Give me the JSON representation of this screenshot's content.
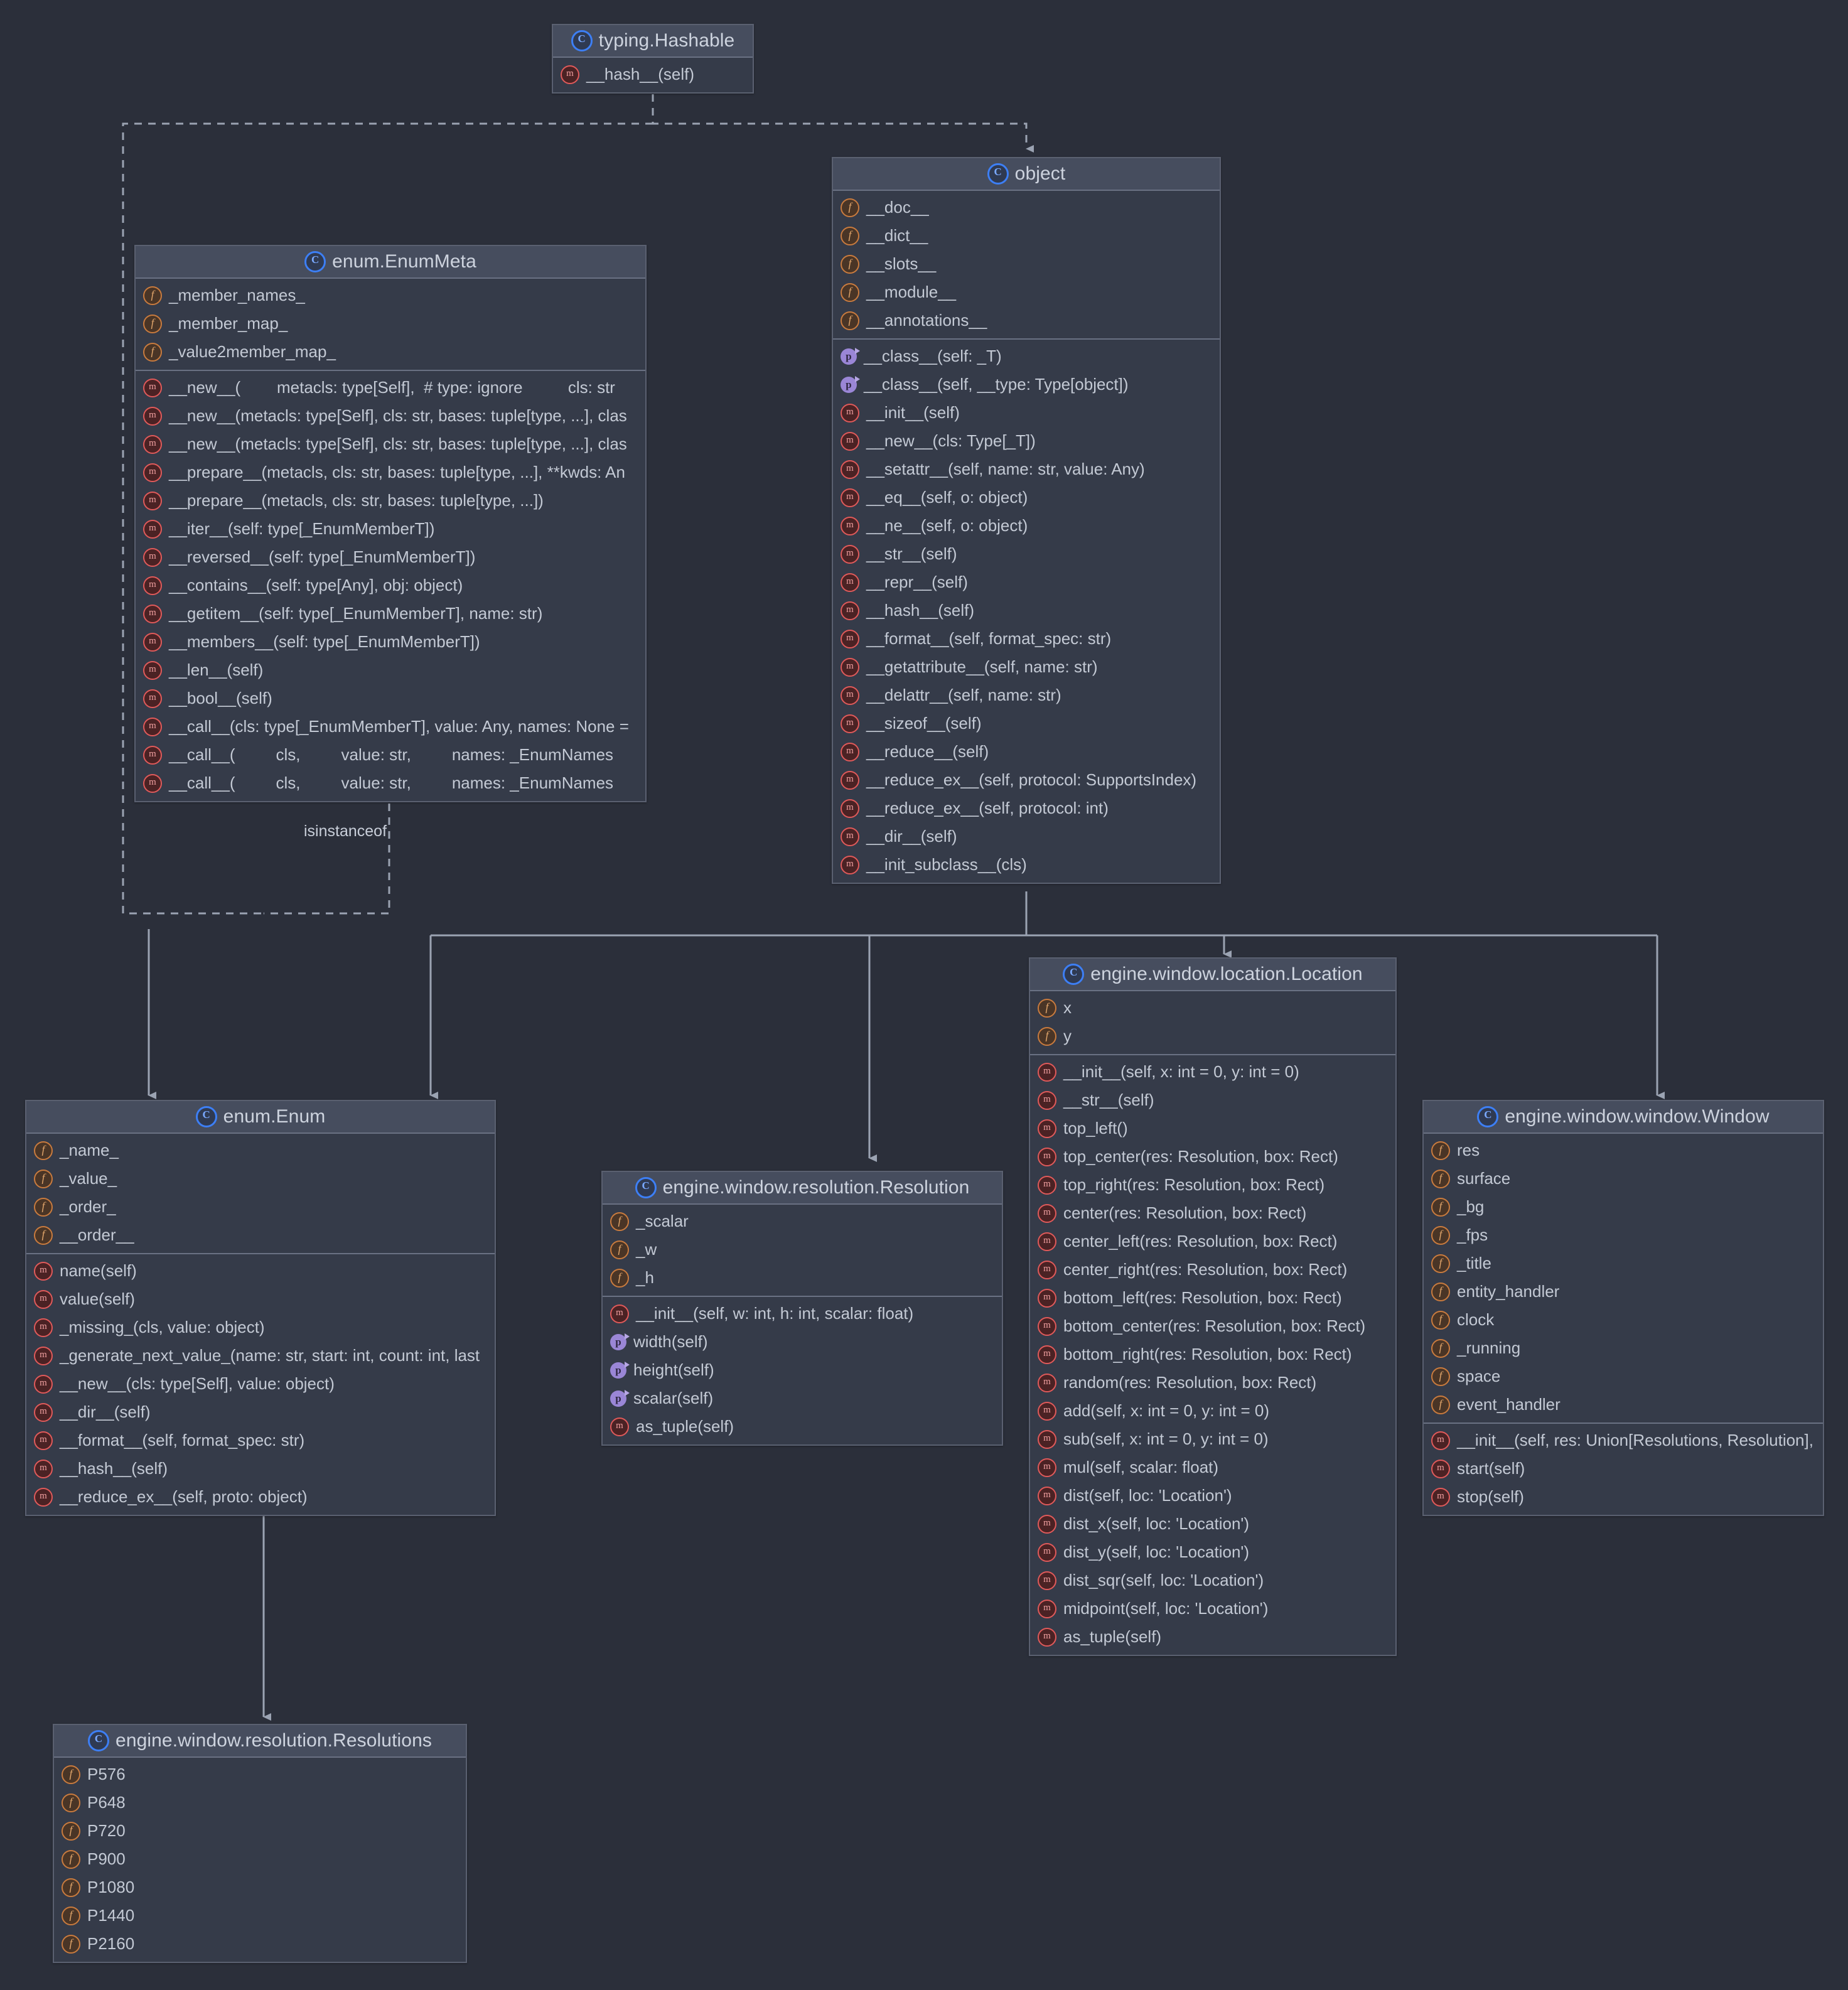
{
  "diagram": {
    "kind": "uml-class-diagram",
    "background": "#2b2f3a",
    "box_fill": "#353b49",
    "header_fill": "#464d5e",
    "border": "#5a6070",
    "text": "#c3c9d4",
    "class_icon_color": "#3d7ff5",
    "field_icon_color": "#c97b3e",
    "method_icon_color": "#e05a5a",
    "property_icon_color": "#9a86d6"
  },
  "edge_labels": [
    {
      "text": "isinstanceof"
    }
  ],
  "classes": [
    {
      "id": "hashable",
      "title": "typing.Hashable",
      "icon": "class-icon",
      "sections": [
        {
          "members": [
            {
              "icon": "method-icon",
              "text": "__hash__(self)"
            }
          ]
        }
      ]
    },
    {
      "id": "object",
      "title": "object",
      "icon": "class-icon",
      "sections": [
        {
          "members": [
            {
              "icon": "field-icon",
              "text": "__doc__"
            },
            {
              "icon": "field-icon",
              "text": "__dict__"
            },
            {
              "icon": "field-icon",
              "text": "__slots__"
            },
            {
              "icon": "field-icon",
              "text": "__module__"
            },
            {
              "icon": "field-icon",
              "text": "__annotations__"
            }
          ]
        },
        {
          "members": [
            {
              "icon": "property-icon",
              "text": "__class__(self: _T)"
            },
            {
              "icon": "property-icon",
              "text": "__class__(self, __type: Type[object])"
            },
            {
              "icon": "method-icon",
              "text": "__init__(self)"
            },
            {
              "icon": "method-icon",
              "text": "__new__(cls: Type[_T])"
            },
            {
              "icon": "method-icon",
              "text": "__setattr__(self, name: str, value: Any)"
            },
            {
              "icon": "method-icon",
              "text": "__eq__(self, o: object)"
            },
            {
              "icon": "method-icon",
              "text": "__ne__(self, o: object)"
            },
            {
              "icon": "method-icon",
              "text": "__str__(self)"
            },
            {
              "icon": "method-icon",
              "text": "__repr__(self)"
            },
            {
              "icon": "method-icon",
              "text": "__hash__(self)"
            },
            {
              "icon": "method-icon",
              "text": "__format__(self, format_spec: str)"
            },
            {
              "icon": "method-icon",
              "text": "__getattribute__(self, name: str)"
            },
            {
              "icon": "method-icon",
              "text": "__delattr__(self, name: str)"
            },
            {
              "icon": "method-icon",
              "text": "__sizeof__(self)"
            },
            {
              "icon": "method-icon",
              "text": "__reduce__(self)"
            },
            {
              "icon": "method-icon",
              "text": "__reduce_ex__(self, protocol: SupportsIndex)"
            },
            {
              "icon": "method-icon",
              "text": "__reduce_ex__(self, protocol: int)"
            },
            {
              "icon": "method-icon",
              "text": "__dir__(self)"
            },
            {
              "icon": "method-icon",
              "text": "__init_subclass__(cls)"
            }
          ]
        }
      ]
    },
    {
      "id": "enummeta",
      "title": "enum.EnumMeta",
      "icon": "class-icon",
      "sections": [
        {
          "members": [
            {
              "icon": "field-icon",
              "text": "_member_names_"
            },
            {
              "icon": "field-icon",
              "text": "_member_map_"
            },
            {
              "icon": "field-icon",
              "text": "_value2member_map_"
            }
          ]
        },
        {
          "members": [
            {
              "icon": "method-icon",
              "text": "__new__(        metacls: type[Self],  # type: ignore          cls: str"
            },
            {
              "icon": "method-icon",
              "text": "__new__(metacls: type[Self], cls: str, bases: tuple[type, ...], clas"
            },
            {
              "icon": "method-icon",
              "text": "__new__(metacls: type[Self], cls: str, bases: tuple[type, ...], clas"
            },
            {
              "icon": "method-icon",
              "text": "__prepare__(metacls, cls: str, bases: tuple[type, ...], **kwds: An"
            },
            {
              "icon": "method-icon",
              "text": "__prepare__(metacls, cls: str, bases: tuple[type, ...])"
            },
            {
              "icon": "method-icon",
              "text": "__iter__(self: type[_EnumMemberT])"
            },
            {
              "icon": "method-icon",
              "text": "__reversed__(self: type[_EnumMemberT])"
            },
            {
              "icon": "method-icon",
              "text": "__contains__(self: type[Any], obj: object)"
            },
            {
              "icon": "method-icon",
              "text": "__getitem__(self: type[_EnumMemberT], name: str)"
            },
            {
              "icon": "method-icon",
              "text": "__members__(self: type[_EnumMemberT])"
            },
            {
              "icon": "method-icon",
              "text": "__len__(self)"
            },
            {
              "icon": "method-icon",
              "text": "__bool__(self)"
            },
            {
              "icon": "method-icon",
              "text": "__call__(cls: type[_EnumMemberT], value: Any, names: None = "
            },
            {
              "icon": "method-icon",
              "text": "__call__(         cls,         value: str,         names: _EnumNames"
            },
            {
              "icon": "method-icon",
              "text": "__call__(         cls,         value: str,         names: _EnumNames"
            }
          ]
        }
      ]
    },
    {
      "id": "enum",
      "title": "enum.Enum",
      "icon": "class-icon",
      "sections": [
        {
          "members": [
            {
              "icon": "field-icon",
              "text": "_name_"
            },
            {
              "icon": "field-icon",
              "text": "_value_"
            },
            {
              "icon": "field-icon",
              "text": "_order_"
            },
            {
              "icon": "field-icon",
              "text": "__order__"
            }
          ]
        },
        {
          "members": [
            {
              "icon": "method-icon",
              "text": "name(self)"
            },
            {
              "icon": "method-icon",
              "text": "value(self)"
            },
            {
              "icon": "method-icon",
              "text": "_missing_(cls, value: object)"
            },
            {
              "icon": "method-icon",
              "text": "_generate_next_value_(name: str, start: int, count: int, last"
            },
            {
              "icon": "method-icon",
              "text": "__new__(cls: type[Self], value: object)"
            },
            {
              "icon": "method-icon",
              "text": "__dir__(self)"
            },
            {
              "icon": "method-icon",
              "text": "__format__(self, format_spec: str)"
            },
            {
              "icon": "method-icon",
              "text": "__hash__(self)"
            },
            {
              "icon": "method-icon",
              "text": "__reduce_ex__(self, proto: object)"
            }
          ]
        }
      ]
    },
    {
      "id": "resolution",
      "title": "engine.window.resolution.Resolution",
      "icon": "class-icon",
      "sections": [
        {
          "members": [
            {
              "icon": "field-icon",
              "text": "_scalar"
            },
            {
              "icon": "field-icon",
              "text": "_w"
            },
            {
              "icon": "field-icon",
              "text": "_h"
            }
          ]
        },
        {
          "members": [
            {
              "icon": "method-icon",
              "text": "__init__(self, w: int, h: int, scalar: float)"
            },
            {
              "icon": "property-icon",
              "text": "width(self)"
            },
            {
              "icon": "property-icon",
              "text": "height(self)"
            },
            {
              "icon": "property-icon",
              "text": "scalar(self)"
            },
            {
              "icon": "method-icon",
              "text": "as_tuple(self)"
            }
          ]
        }
      ]
    },
    {
      "id": "location",
      "title": "engine.window.location.Location",
      "icon": "class-icon",
      "sections": [
        {
          "members": [
            {
              "icon": "field-icon",
              "text": "x"
            },
            {
              "icon": "field-icon",
              "text": "y"
            }
          ]
        },
        {
          "members": [
            {
              "icon": "method-icon",
              "text": "__init__(self, x: int = 0, y: int = 0)"
            },
            {
              "icon": "method-icon",
              "text": "__str__(self)"
            },
            {
              "icon": "method-icon",
              "text": "top_left()"
            },
            {
              "icon": "method-icon",
              "text": "top_center(res: Resolution, box: Rect)"
            },
            {
              "icon": "method-icon",
              "text": "top_right(res: Resolution, box: Rect)"
            },
            {
              "icon": "method-icon",
              "text": "center(res: Resolution, box: Rect)"
            },
            {
              "icon": "method-icon",
              "text": "center_left(res: Resolution, box: Rect)"
            },
            {
              "icon": "method-icon",
              "text": "center_right(res: Resolution, box: Rect)"
            },
            {
              "icon": "method-icon",
              "text": "bottom_left(res: Resolution, box: Rect)"
            },
            {
              "icon": "method-icon",
              "text": "bottom_center(res: Resolution, box: Rect)"
            },
            {
              "icon": "method-icon",
              "text": "bottom_right(res: Resolution, box: Rect)"
            },
            {
              "icon": "method-icon",
              "text": "random(res: Resolution, box: Rect)"
            },
            {
              "icon": "method-icon",
              "text": "add(self, x: int = 0, y: int = 0)"
            },
            {
              "icon": "method-icon",
              "text": "sub(self, x: int = 0, y: int = 0)"
            },
            {
              "icon": "method-icon",
              "text": "mul(self, scalar: float)"
            },
            {
              "icon": "method-icon",
              "text": "dist(self, loc: 'Location')"
            },
            {
              "icon": "method-icon",
              "text": "dist_x(self, loc: 'Location')"
            },
            {
              "icon": "method-icon",
              "text": "dist_y(self, loc: 'Location')"
            },
            {
              "icon": "method-icon",
              "text": "dist_sqr(self, loc: 'Location')"
            },
            {
              "icon": "method-icon",
              "text": "midpoint(self, loc: 'Location')"
            },
            {
              "icon": "method-icon",
              "text": "as_tuple(self)"
            }
          ]
        }
      ]
    },
    {
      "id": "window",
      "title": "engine.window.window.Window",
      "icon": "class-icon",
      "sections": [
        {
          "members": [
            {
              "icon": "field-icon",
              "text": "res"
            },
            {
              "icon": "field-icon",
              "text": "surface"
            },
            {
              "icon": "field-icon",
              "text": "_bg"
            },
            {
              "icon": "field-icon",
              "text": "_fps"
            },
            {
              "icon": "field-icon",
              "text": "_title"
            },
            {
              "icon": "field-icon",
              "text": "entity_handler"
            },
            {
              "icon": "field-icon",
              "text": "clock"
            },
            {
              "icon": "field-icon",
              "text": "_running"
            },
            {
              "icon": "field-icon",
              "text": "space"
            },
            {
              "icon": "field-icon",
              "text": "event_handler"
            }
          ]
        },
        {
          "members": [
            {
              "icon": "method-icon",
              "text": "__init__(self, res: Union[Resolutions, Resolution],"
            },
            {
              "icon": "method-icon",
              "text": "start(self)"
            },
            {
              "icon": "method-icon",
              "text": "stop(self)"
            }
          ]
        }
      ]
    },
    {
      "id": "resolutions",
      "title": "engine.window.resolution.Resolutions",
      "icon": "class-icon",
      "sections": [
        {
          "members": [
            {
              "icon": "field-icon",
              "text": "P576"
            },
            {
              "icon": "field-icon",
              "text": "P648"
            },
            {
              "icon": "field-icon",
              "text": "P720"
            },
            {
              "icon": "field-icon",
              "text": "P900"
            },
            {
              "icon": "field-icon",
              "text": "P1080"
            },
            {
              "icon": "field-icon",
              "text": "P1440"
            },
            {
              "icon": "field-icon",
              "text": "P2160"
            }
          ]
        }
      ]
    }
  ]
}
